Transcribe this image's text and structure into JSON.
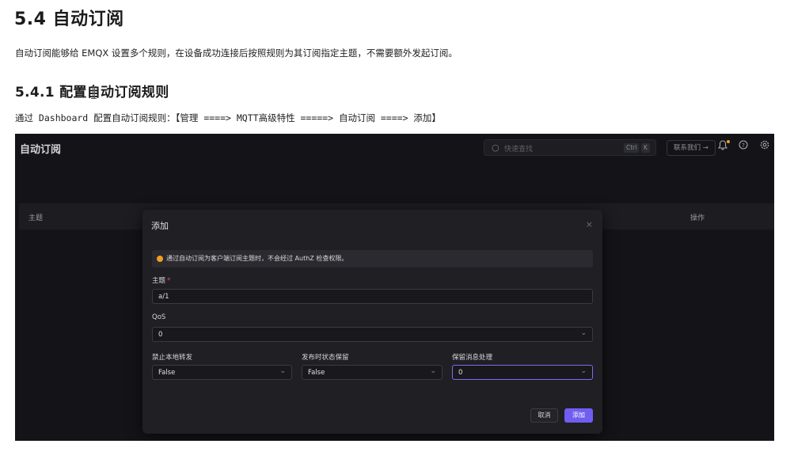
{
  "doc": {
    "heading": "5.4 自动订阅",
    "intro": "自动订阅能够给 EMQX 设置多个规则，在设备成功连接后按照规则为其订阅指定主题，不需要额外发起订阅。",
    "subheading": "5.4.1 配置自动订阅规则",
    "instruction": "通过 Dashboard 配置自动订阅规则：【管理 ====> MQTT高级特性 =====> 自动订阅 ====> 添加】"
  },
  "app": {
    "title": "自动订阅",
    "search_placeholder": "快速查找",
    "search_kbd_1": "Ctrl",
    "search_kbd_2": "K",
    "contact_label": "联系我们 →",
    "icons": [
      "search-icon",
      "bell-icon",
      "help-icon",
      "settings-icon"
    ],
    "table": {
      "col_topic": "主题",
      "col_actions": "操作"
    }
  },
  "modal": {
    "title": "添加",
    "close_symbol": "×",
    "alert": "通过自动订阅为客户端订阅主题时，不会经过 AuthZ 检查权限。",
    "topic_label": "主题",
    "topic_required": "*",
    "topic_value": "a/1",
    "qos_label": "QoS",
    "qos_value": "0",
    "nl_label": "禁止本地转发",
    "nl_value": "False",
    "rap_label": "发布时状态保留",
    "rap_value": "False",
    "rh_label": "保留消息处理",
    "rh_value": "0",
    "cancel_label": "取消",
    "add_label": "添加"
  },
  "colors": {
    "accent": "#6f5ef0",
    "warning": "#f0a020",
    "app_bg": "#141418",
    "modal_bg": "#1f1f24"
  }
}
